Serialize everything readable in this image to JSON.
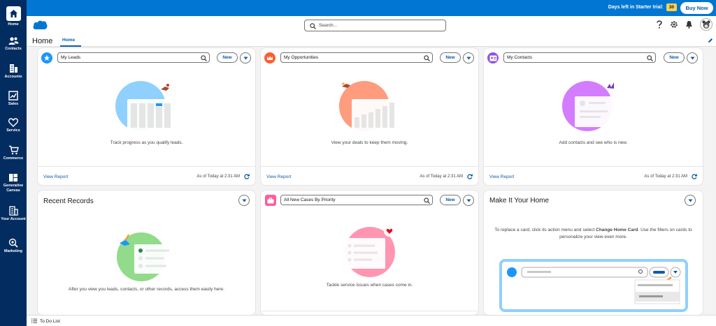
{
  "rail": {
    "items": [
      {
        "label": "Home",
        "icon": "home-icon"
      },
      {
        "label": "Contacts",
        "icon": "contacts-icon"
      },
      {
        "label": "Accounts",
        "icon": "accounts-icon"
      },
      {
        "label": "Sales",
        "icon": "sales-icon"
      },
      {
        "label": "Service",
        "icon": "service-icon"
      },
      {
        "label": "Commerce",
        "icon": "commerce-icon"
      },
      {
        "label": "Generative Canvas",
        "icon": "generative-canvas-icon"
      },
      {
        "label": "Your Account",
        "icon": "your-account-icon"
      },
      {
        "label": "Marketing",
        "icon": "marketing-icon"
      }
    ]
  },
  "topbar": {
    "trial_text": "Days left in Starter trial:",
    "days": "30",
    "buy_label": "Buy Now",
    "color": "#0176d3"
  },
  "header": {
    "search_placeholder": "Search..."
  },
  "page": {
    "title": "Home",
    "tab": "Home"
  },
  "cards": {
    "leads": {
      "select": "My Leads",
      "new_label": "New",
      "caption": "Track progress as you qualify leads.",
      "view_report": "View Report",
      "as_of": "As of Today at 2:31 AM"
    },
    "opportunities": {
      "select": "My Opportunities",
      "new_label": "New",
      "caption": "View your deals to keep them moving.",
      "view_report": "View Report",
      "as_of": "As of Today at 2:31 AM"
    },
    "contacts": {
      "select": "My Contacts",
      "new_label": "New",
      "caption": "Add contacts and see who is new.",
      "view_report": "View Report",
      "as_of": "As of Today at 2:31 AM"
    },
    "recent": {
      "title": "Recent Records",
      "caption": "After you view you leads, contacts, or other records, access them easily here."
    },
    "cases": {
      "select": "All New Cases By Priority",
      "new_label": "New",
      "caption": "Tackle service issues when cases come in."
    },
    "make_home": {
      "title": "Make It Your Home",
      "desc_pre": "To replace a card, click its action menu and select ",
      "desc_bold": "Change Home Card",
      "desc_post": ". Use the filters on cards to personalize your view even more."
    }
  },
  "bottom": {
    "todo": "To Do List"
  }
}
